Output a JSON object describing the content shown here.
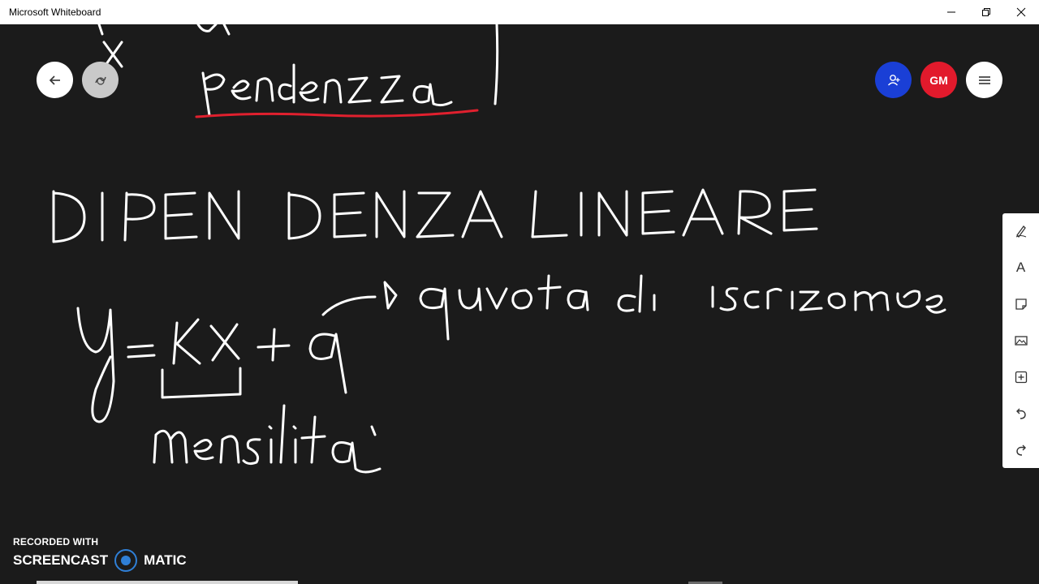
{
  "window": {
    "title": "Microsoft Whiteboard"
  },
  "header": {
    "user_initials": "GM"
  },
  "toolbar": {
    "text_tool_glyph": "A"
  },
  "board": {
    "handwriting": {
      "top_word": "pendenza",
      "title": "DIPENDENZA LINEARE",
      "equation": "y = kx + q",
      "annotation_right": "quota di iscrizione",
      "annotation_below": "mensilità"
    },
    "ink_colors": {
      "stroke": "#ffffff",
      "highlight": "#e0202e"
    }
  },
  "watermark": {
    "line1": "RECORDED WITH",
    "brand_left": "SCREENCAST",
    "brand_right": "MATIC"
  }
}
